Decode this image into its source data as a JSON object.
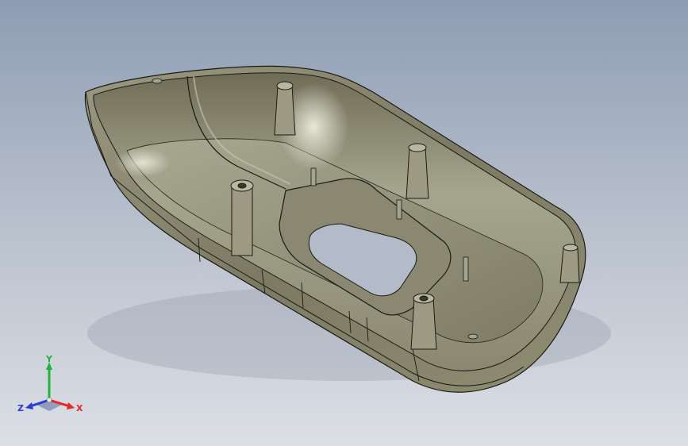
{
  "viewport": {
    "background_top": "#8e9cb3",
    "background_bottom": "#dcdfe5"
  },
  "model": {
    "description_icon": "cad-housing-shell",
    "shell_color": "#8c8a6e",
    "highlight_color": "#d8d7c4",
    "edge_color": "#1a1a14"
  },
  "triad": {
    "x_label": "X",
    "y_label": "Y",
    "z_label": "Z",
    "x_color": "#e8262a",
    "y_color": "#22b43a",
    "z_color": "#2a3ed6"
  }
}
